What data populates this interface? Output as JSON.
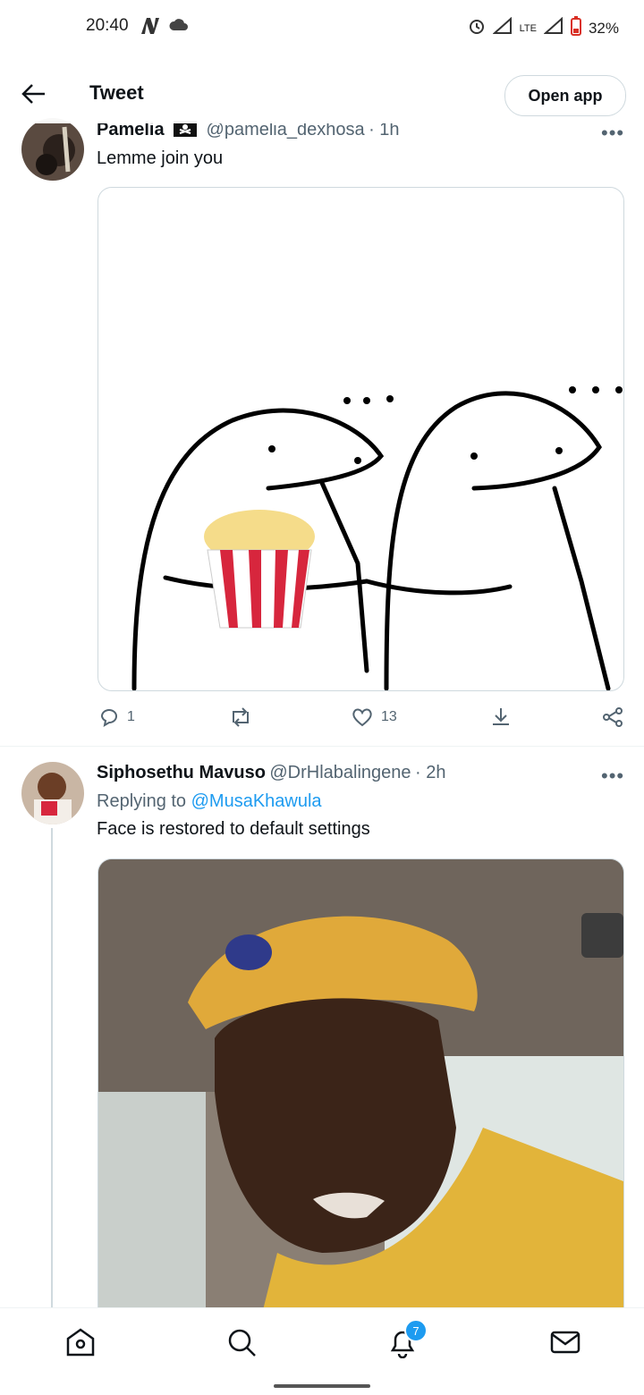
{
  "status_bar": {
    "time": "20:40",
    "network": "LTE",
    "battery": "32%"
  },
  "header": {
    "title": "Tweet",
    "open_app_label": "Open app"
  },
  "tweets": [
    {
      "display_name": "Pamelia",
      "handle": "@pamelia_dexhosa",
      "time": "· 1h",
      "text": "Lemme join you",
      "replies": "1",
      "retweets": "",
      "likes": "13"
    },
    {
      "display_name": "Siphosethu Mavuso",
      "handle": "@DrHlabalingene",
      "time": "· 2h",
      "replying_prefix": "Replying to",
      "replying_to": "@MusaKhawula",
      "text": "Face is restored to default settings"
    }
  ],
  "bottom_nav": {
    "notifications_badge": "7"
  },
  "colors": {
    "accent": "#1d9bf0",
    "secondary_text": "#536471",
    "border": "#cfd9de"
  }
}
